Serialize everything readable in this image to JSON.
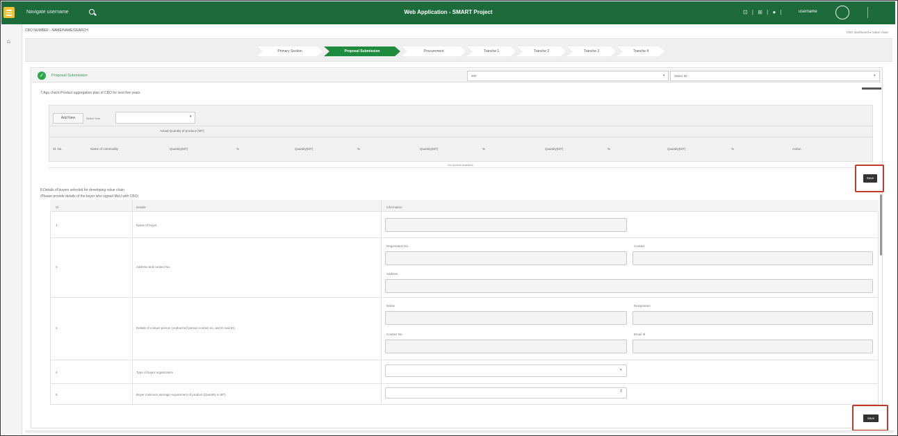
{
  "topbar": {
    "brand": "Navigate username",
    "title": "Web Application - SMART Project",
    "icons_text": "⊡ | ⊞ | ● |",
    "user": "username",
    "accent": "#1d6b3a",
    "menu_color": "#f2c230"
  },
  "breadcrumb": {
    "left": "CBO NUMBER - NAME/NAME/SEARCH",
    "right": "CBO dashboard ▸ Value chain"
  },
  "steps": [
    {
      "label": "Primary Section",
      "active": false
    },
    {
      "label": "Proposal Submission",
      "active": true
    },
    {
      "label": "Procurement",
      "active": false
    },
    {
      "label": "Tranche 1",
      "active": false
    },
    {
      "label": "Tranche 2",
      "active": false
    },
    {
      "label": "Tranche 3",
      "active": false
    },
    {
      "label": "Tranche 4",
      "active": false
    }
  ],
  "section": {
    "title": "Proposal Submission",
    "select1": "###",
    "select2": "Select ID",
    "note": "7.Aga check-Product aggregation plan of CBO for next five years"
  },
  "table1": {
    "add_new": "Add New",
    "select_year_label": "Select Year",
    "group_header": "Actual Quantity of produce (MT)",
    "columns": [
      "Sl. No.",
      "Name of commodity",
      "Quantity(MT)",
      "%",
      "Quantity(MT)",
      "%",
      "Quantity(MT)",
      "%",
      "Quantity(MT)",
      "%",
      "Quantity(MT)",
      "%",
      "Action"
    ],
    "empty_text": "No records available."
  },
  "save_label": "Save",
  "buyers": {
    "note1": "8.Details of buyers selected for developing value chain",
    "note2": "(Please provide details of the buyer who signed MoU with CBO)",
    "headers": [
      "Sl.",
      "Details",
      "Information"
    ],
    "rows": [
      {
        "sl": "1",
        "detail": "Name of buyer"
      },
      {
        "sl": "2",
        "detail": "Address and contact No."
      },
      {
        "sl": "3",
        "detail": "Details of contact person (Authorized person contact no. and E mail ID)"
      },
      {
        "sl": "4",
        "detail": "Type of buyer organization"
      },
      {
        "sl": "5",
        "detail": "Buyer minimum average requirement of product (Quantity in MT)"
      }
    ],
    "labels": {
      "org_no": "Registration No.",
      "contact": "Contact",
      "address": "Address",
      "name": "Name",
      "designation": "Designation",
      "contact_no": "Contact No.",
      "email": "Email Id"
    }
  }
}
